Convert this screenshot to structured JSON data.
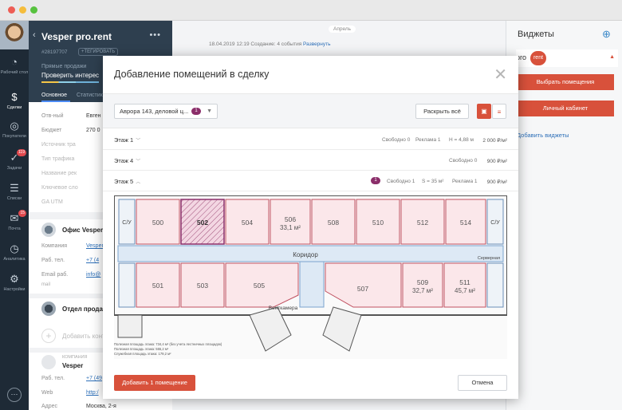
{
  "nav": {
    "items": [
      {
        "label": "Рабочий стол",
        "icon": "speedometer-icon"
      },
      {
        "label": "Сделки",
        "icon": "dollar-icon"
      },
      {
        "label": "Покупатели",
        "icon": "buyers-icon"
      },
      {
        "label": "Задачи",
        "icon": "check-icon",
        "badge": "119"
      },
      {
        "label": "Списки",
        "icon": "list-icon"
      },
      {
        "label": "Почта",
        "icon": "mail-icon",
        "badge": "15"
      },
      {
        "label": "Аналитика",
        "icon": "chart-icon"
      },
      {
        "label": "Настройки",
        "icon": "gear-icon"
      }
    ]
  },
  "card": {
    "title": "Vesper pro.rent",
    "id": "#28197707",
    "tag": "+ТЕГИРОВАТЬ",
    "pipeline": "Прямые продажи",
    "stage": "Проверить интерес",
    "tabs": [
      "Основное",
      "Статистик"
    ],
    "fields": [
      {
        "label": "Отв-ный",
        "value": "Евген"
      },
      {
        "label": "Бюджет",
        "value": "270 0"
      },
      {
        "label": "Источник тра",
        "value": ""
      },
      {
        "label": "Тип трафика",
        "value": ""
      },
      {
        "label": "Название рек",
        "value": ""
      },
      {
        "label": "Ключевое сло",
        "value": ""
      },
      {
        "label": "GA UTM",
        "value": ""
      }
    ],
    "contact1": {
      "name": "Офис Vesper",
      "fields": [
        {
          "label": "Компания",
          "value": "Vesper"
        },
        {
          "label": "Раб. тел.",
          "value": "+7 (4"
        },
        {
          "label": "Email раб.",
          "value": "info@"
        }
      ],
      "more": "mail"
    },
    "contact2": {
      "name": "Отдел продаж"
    },
    "add_contact": "Добавить конт",
    "company": {
      "caption": "КОМПАНИЯ",
      "name": "Vesper",
      "fields": [
        {
          "label": "Раб. тел.",
          "value": "+7 (49"
        },
        {
          "label": "Web",
          "value": "http:/"
        },
        {
          "label": "Адрес",
          "value": "Москва, 2-я"
        }
      ]
    }
  },
  "feed": {
    "date": "Апрель",
    "note_prefix": "18.04.2019 12:19 Создание: 4 события",
    "note_link": "Развернуть"
  },
  "widgets": {
    "title": "Виджеты",
    "logo_pro": "pro",
    "logo_rent": "rent",
    "btn_select": "Выбрать помещения",
    "btn_cabinet": "Личный кабинет",
    "add": "Добавить виджеты"
  },
  "modal": {
    "title": "Добавление помещений в сделку",
    "object_select": "Аврора 143, деловой ц...",
    "object_count": "1",
    "expand_all": "Раскрыть всё",
    "floors": [
      {
        "name": "Этаж 1",
        "free": "Свободно 0",
        "ads": "Реклама 1",
        "height": "H = 4,88 м",
        "price": "2 000 ₽/м²"
      },
      {
        "name": "Этаж 4",
        "free": "Свободно 0",
        "price": "900 ₽/м²"
      },
      {
        "name": "Этаж 5",
        "badge": "1",
        "free": "Свободно 1",
        "area": "S = 35 м²",
        "ads": "Реклама 1",
        "price": "900 ₽/м²"
      }
    ],
    "plan": {
      "rooms": [
        "500",
        "502",
        "504",
        "506",
        "508",
        "510",
        "512",
        "514",
        "501",
        "503",
        "505",
        "507",
        "509",
        "511"
      ],
      "areas": {
        "506": "33,1 м²",
        "509": "32,7 м²",
        "511": "45,7 м²"
      },
      "corridor": "Коридор",
      "stair": "С/У",
      "vent": "Венткамера",
      "server": "Серверная",
      "notes": [
        "Полезная площадь этажа: 734,4 м² (без учета лестничных площадок)",
        "Полезная площадь этажа: 555,2 м²",
        "Служебная площадь этажа: 179,2 м²"
      ]
    },
    "add_button": "Добавить 1 помещение",
    "cancel_button": "Отмена"
  },
  "colors": {
    "accent": "#d8513b",
    "nav_bg": "#1e2a36",
    "card_head": "#2e3f4f",
    "badge": "#8b2e6a",
    "room_fill": "#fbe7ea",
    "room_stroke": "#c05060",
    "corridor": "#dde9f5"
  }
}
